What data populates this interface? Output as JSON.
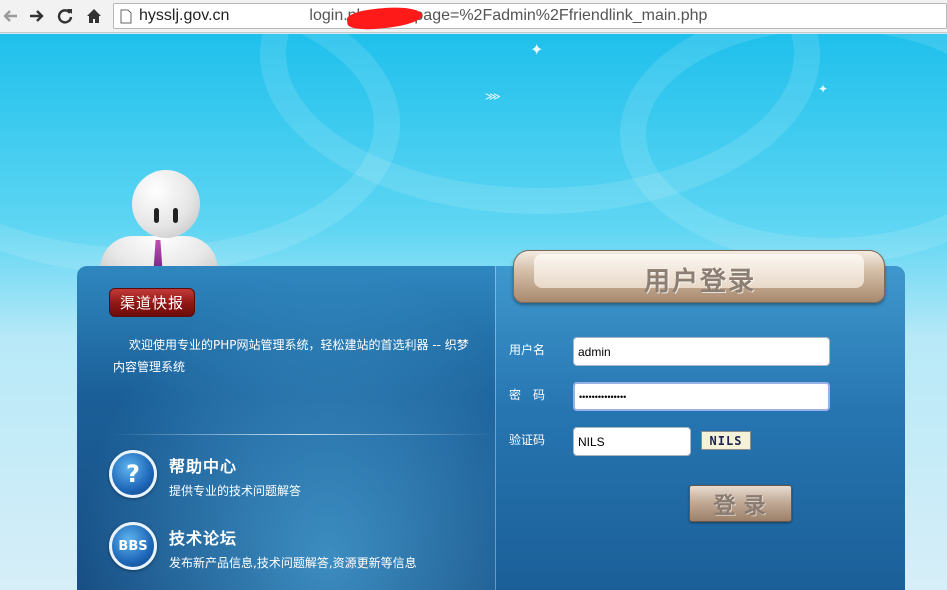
{
  "browser": {
    "url_prefix": "hysslj.gov.cn",
    "url_suffix": "login.php?gotopage=%2Fadmin%2Ffriendlink_main.php",
    "icons": [
      "back-arrow-icon",
      "forward-arrow-icon",
      "reload-icon",
      "home-icon",
      "page-icon"
    ]
  },
  "left_panel": {
    "news_badge": "渠道快报",
    "welcome_text": "欢迎使用专业的PHP网站管理系统，轻松建站的首选利器 -- 织梦内容管理系统",
    "features": [
      {
        "icon": "question-icon",
        "icon_text": "?",
        "title": "帮助中心",
        "desc": "提供专业的技术问题解答"
      },
      {
        "icon": "bbs-icon",
        "icon_text": "BBS",
        "title": "技术论坛",
        "desc": "发布新产品信息,技术问题解答,资源更新等信息"
      }
    ]
  },
  "login": {
    "title": "用户登录",
    "username_label": "用户名",
    "username_value": "admin",
    "password_label": "密　码",
    "password_value": "•••••••••••••••",
    "captcha_label": "验证码",
    "captcha_value": "NILS",
    "captcha_image_text": "NILS",
    "submit_label": "登录"
  },
  "colors": {
    "panel_blue": "#1b5f98",
    "badge_red": "#8e1614",
    "login_tan": "#c2ab98"
  }
}
